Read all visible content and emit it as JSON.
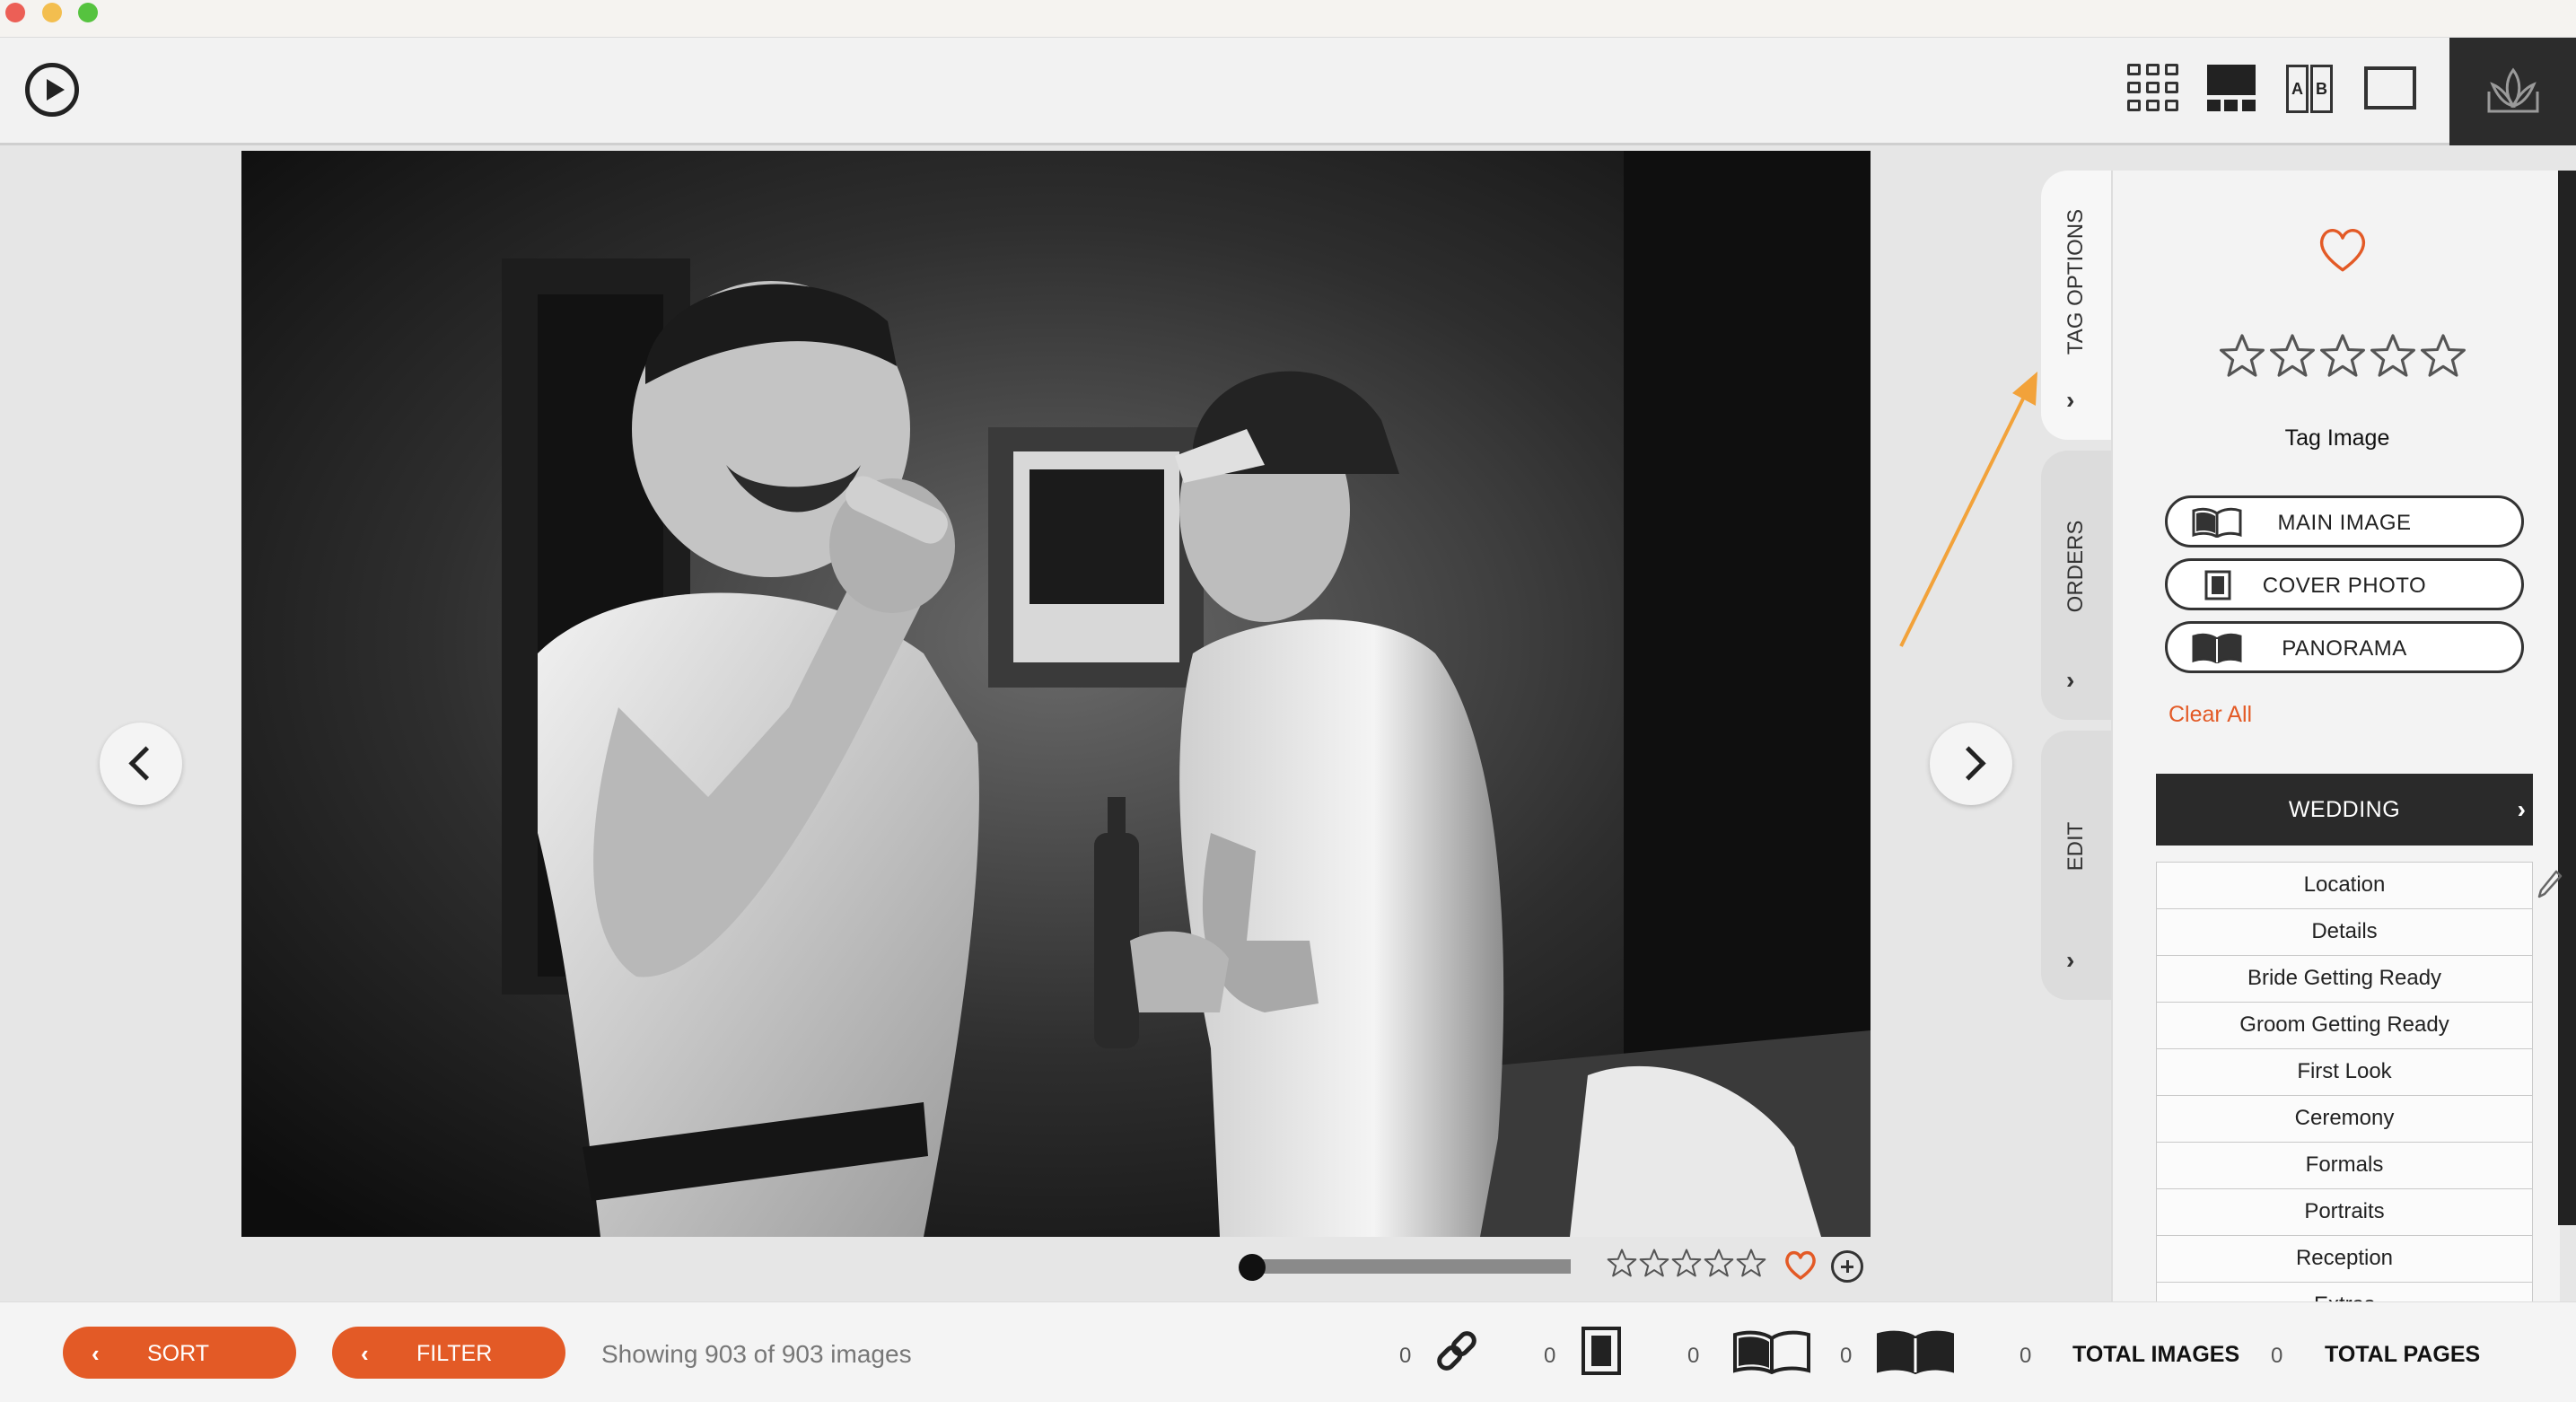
{
  "toolbar": {
    "play_icon": "play-circle-icon",
    "view_modes": [
      "grid-view-icon",
      "loupe-view-icon",
      "compare-view-icon",
      "single-view-icon"
    ],
    "compare_a": "A",
    "compare_b": "B",
    "logo_icon": "lotus-logo-icon"
  },
  "viewer": {
    "prev_icon": "chevron-left-icon",
    "next_icon": "chevron-right-icon",
    "zoom_level": 0
  },
  "side_tabs": {
    "tag_options": "TAG OPTIONS",
    "orders": "ORDERS",
    "edit": "EDIT",
    "chevron": "›"
  },
  "tag_panel": {
    "tag_image_label": "Tag Image",
    "rating": 0,
    "favorite": false,
    "buttons": {
      "main_image": "MAIN IMAGE",
      "cover_photo": "COVER PHOTO",
      "panorama": "PANORAMA"
    },
    "clear_all": "Clear All",
    "category_header": "WEDDING",
    "category_chevron": "›",
    "categories": [
      "Location",
      "Details",
      "Bride Getting Ready",
      "Groom Getting Ready",
      "First Look",
      "Ceremony",
      "Formals",
      "Portraits",
      "Reception",
      "Extras"
    ]
  },
  "footer": {
    "sort_label": "SORT",
    "filter_label": "FILTER",
    "chevron": "‹",
    "showing_text": "Showing 903 of 903 images",
    "counts": {
      "linked": "0",
      "cover": "0",
      "main": "0",
      "panorama": "0",
      "total_images_count": "0",
      "total_pages_count": "0"
    },
    "total_images_label": "TOTAL IMAGES",
    "total_pages_label": "TOTAL PAGES"
  },
  "colors": {
    "accent": "#e35a26",
    "dark": "#2a2a2a",
    "arrow": "#f2a23a"
  }
}
